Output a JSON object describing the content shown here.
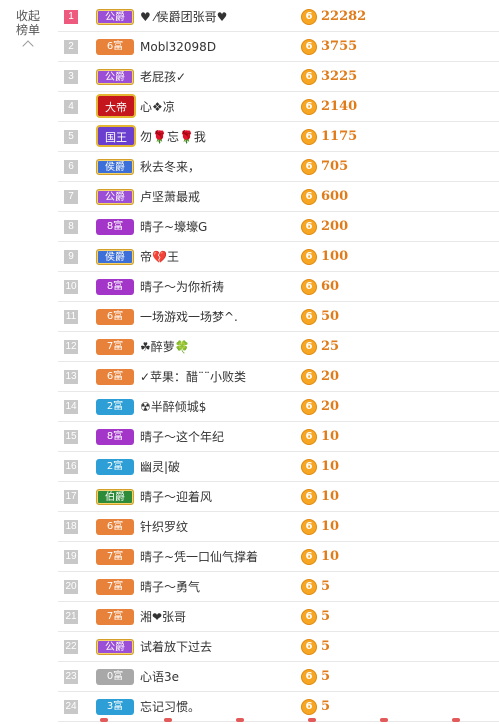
{
  "sidebar": {
    "collapse_label_line1": "收起",
    "collapse_label_line2": "榜单"
  },
  "rows": [
    {
      "rank": "1",
      "badge": "公爵",
      "badge_color": "#9b4fd6",
      "badge_kind": "gov",
      "name": "♥ ⁄侯爵团张哥♥",
      "score": "22282"
    },
    {
      "rank": "2",
      "badge": "6富",
      "badge_color": "#e8823a",
      "badge_kind": "rich",
      "name": "Mobl32098D",
      "score": "3755"
    },
    {
      "rank": "3",
      "badge": "公爵",
      "badge_color": "#9b4fd6",
      "badge_kind": "gov",
      "name": "老屁孩✓",
      "score": "3225"
    },
    {
      "rank": "4",
      "badge": "大帝",
      "badge_color": "#c4161c",
      "badge_kind": "emperor",
      "name": "心❖凉",
      "score": "2140"
    },
    {
      "rank": "5",
      "badge": "国王",
      "badge_color": "#6a3fd0",
      "badge_kind": "big",
      "name": "勿🌹忘🌹我",
      "score": "1175"
    },
    {
      "rank": "6",
      "badge": "侯爵",
      "badge_color": "#3d6fd8",
      "badge_kind": "gov",
      "name": "秋去冬来，",
      "score": "705"
    },
    {
      "rank": "7",
      "badge": "公爵",
      "badge_color": "#9b4fd6",
      "badge_kind": "gov",
      "name": "卢坚萧最戒",
      "score": "600"
    },
    {
      "rank": "8",
      "badge": "8富",
      "badge_color": "#a336c9",
      "badge_kind": "rich",
      "name": "晴子~壕壕G",
      "score": "200"
    },
    {
      "rank": "9",
      "badge": "侯爵",
      "badge_color": "#3d6fd8",
      "badge_kind": "gov",
      "name": "帝💔王",
      "score": "100"
    },
    {
      "rank": "10",
      "badge": "8富",
      "badge_color": "#a336c9",
      "badge_kind": "rich",
      "name": "晴子～为你祈祷",
      "score": "60"
    },
    {
      "rank": "11",
      "badge": "6富",
      "badge_color": "#e8823a",
      "badge_kind": "rich",
      "name": "一场游戏一场梦^.",
      "score": "50"
    },
    {
      "rank": "12",
      "badge": "7富",
      "badge_color": "#e8823a",
      "badge_kind": "rich",
      "name": "☘醉萝🍀",
      "score": "25"
    },
    {
      "rank": "13",
      "badge": "6富",
      "badge_color": "#e8823a",
      "badge_kind": "rich",
      "name": "✓苹果：醋¨¨小败类",
      "score": "20"
    },
    {
      "rank": "14",
      "badge": "2富",
      "badge_color": "#2d9fd6",
      "badge_kind": "rich",
      "name": "☢半醉倾城$",
      "score": "20"
    },
    {
      "rank": "15",
      "badge": "8富",
      "badge_color": "#a336c9",
      "badge_kind": "rich",
      "name": "晴子～这个年纪",
      "score": "10"
    },
    {
      "rank": "16",
      "badge": "2富",
      "badge_color": "#2d9fd6",
      "badge_kind": "rich",
      "name": "幽灵|破",
      "score": "10"
    },
    {
      "rank": "17",
      "badge": "伯爵",
      "badge_color": "#2e8b3a",
      "badge_kind": "gov",
      "name": "晴子～迎着风",
      "score": "10"
    },
    {
      "rank": "18",
      "badge": "6富",
      "badge_color": "#e8823a",
      "badge_kind": "rich",
      "name": "针织罗纹",
      "score": "10"
    },
    {
      "rank": "19",
      "badge": "7富",
      "badge_color": "#e8823a",
      "badge_kind": "rich",
      "name": "晴子~凭一口仙气撑着",
      "score": "10"
    },
    {
      "rank": "20",
      "badge": "7富",
      "badge_color": "#e8823a",
      "badge_kind": "rich",
      "name": "晴子～勇气",
      "score": "5"
    },
    {
      "rank": "21",
      "badge": "7富",
      "badge_color": "#e8823a",
      "badge_kind": "rich",
      "name": "湘❤张哥",
      "score": "5"
    },
    {
      "rank": "22",
      "badge": "公爵",
      "badge_color": "#9b4fd6",
      "badge_kind": "gov",
      "name": "试着放下过去",
      "score": "5"
    },
    {
      "rank": "23",
      "badge": "0富",
      "badge_color": "#a8a8a8",
      "badge_kind": "rich",
      "name": "心语3e",
      "score": "5"
    },
    {
      "rank": "24",
      "badge": "3富",
      "badge_color": "#2d9fd6",
      "badge_kind": "rich",
      "name": "忘记习惯。",
      "score": "5"
    }
  ],
  "coin_glyph": "6",
  "colors": {
    "score": "#e07b1a",
    "coin": "#f6a623",
    "rank_top": "#ee5a7e",
    "rank_default": "#c8c8c8"
  }
}
